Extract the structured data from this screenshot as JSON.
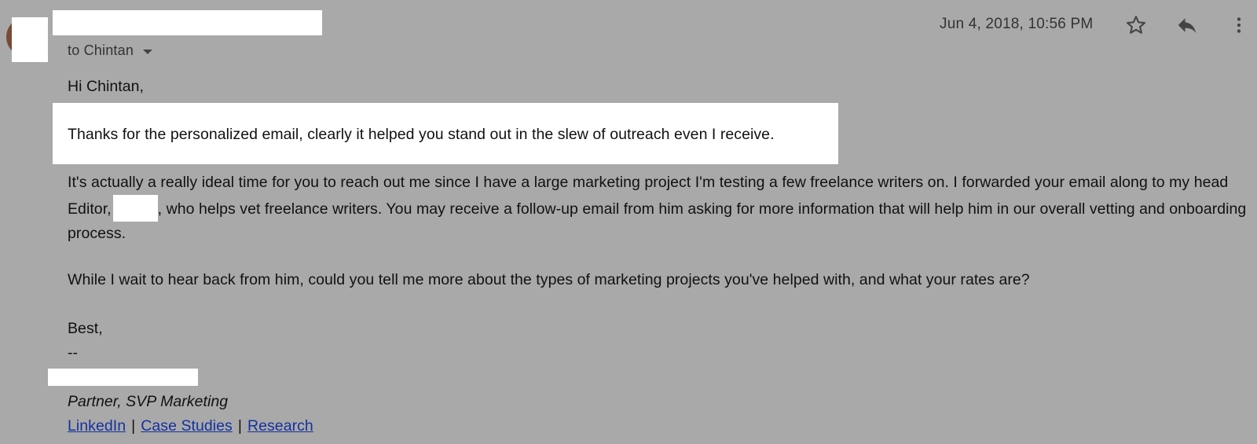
{
  "header": {
    "recipient_label": "to Chintan",
    "date": "Jun 4, 2018, 10:56 PM"
  },
  "body": {
    "greeting": "Hi Chintan,",
    "highlighted_paragraph": "Thanks for the personalized email, clearly it helped you stand out in the slew of outreach even I receive.",
    "paragraph2_part1": "It's actually a really ideal time for you to reach out me since I have a large marketing project I'm testing a few freelance writers on. I forwarded your email along to my head Editor,",
    "paragraph2_part2": ", who helps vet freelance writers. You may receive a follow-up email from him asking for more information that will help him in our overall vetting and onboarding process.",
    "paragraph3": "While I wait to hear back from him, could you tell me more about the types of marketing projects you've helped with, and what your rates are?",
    "signoff": "Best,",
    "signature_separator": "--"
  },
  "signature": {
    "title": "Partner, SVP Marketing",
    "links": [
      "LinkedIn",
      "Case Studies",
      "Research"
    ],
    "separator": "|"
  },
  "icons": {
    "star": "star-icon",
    "reply": "reply-icon",
    "more": "more-vert-icon"
  },
  "colors": {
    "background": "#a9a9a9",
    "redaction": "#ffffff",
    "link": "#15319e"
  }
}
